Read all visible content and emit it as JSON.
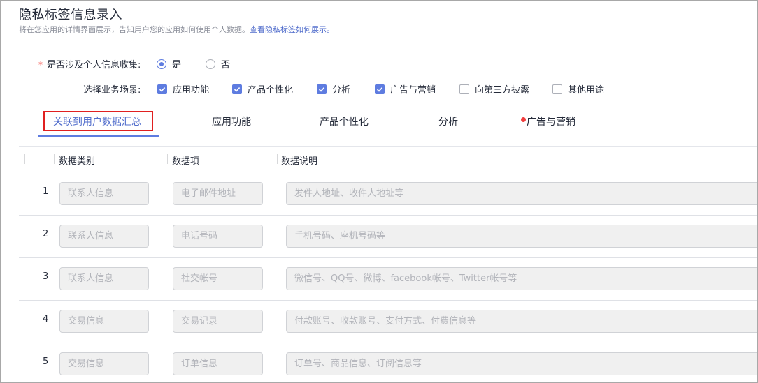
{
  "header": {
    "title": "隐私标签信息录入",
    "subtitle": "将在您应用的详情界面展示，告知用户您的应用如何使用个人数据。",
    "subtitle_link": "查看隐私标签如何展示。"
  },
  "collection": {
    "required_mark": "*",
    "label": "是否涉及个人信息收集:",
    "options": [
      {
        "label": "是",
        "checked": true
      },
      {
        "label": "否",
        "checked": false
      }
    ]
  },
  "scenarios": {
    "label": "选择业务场景:",
    "items": [
      {
        "label": "应用功能",
        "checked": true
      },
      {
        "label": "产品个性化",
        "checked": true
      },
      {
        "label": "分析",
        "checked": true
      },
      {
        "label": "广告与营销",
        "checked": true
      },
      {
        "label": "向第三方披露",
        "checked": false
      },
      {
        "label": "其他用途",
        "checked": false
      }
    ]
  },
  "tabs": [
    {
      "label": "关联到用户数据汇总",
      "active": true
    },
    {
      "label": "应用功能"
    },
    {
      "label": "产品个性化"
    },
    {
      "label": "分析"
    },
    {
      "label": "广告与营销",
      "dot": true
    }
  ],
  "table": {
    "columns": [
      "数据类别",
      "数据项",
      "数据说明"
    ],
    "rows": [
      {
        "index": "1",
        "category": "联系人信息",
        "item": "电子邮件地址",
        "desc": "发件人地址、收件人地址等"
      },
      {
        "index": "2",
        "category": "联系人信息",
        "item": "电话号码",
        "desc": "手机号码、座机号码等"
      },
      {
        "index": "3",
        "category": "联系人信息",
        "item": "社交帐号",
        "desc": "微信号、QQ号、微博、facebook帐号、Twitter帐号等"
      },
      {
        "index": "4",
        "category": "交易信息",
        "item": "交易记录",
        "desc": "付款账号、收款账号、支付方式、付费信息等"
      },
      {
        "index": "5",
        "category": "交易信息",
        "item": "订单信息",
        "desc": "订单号、商品信息、订阅信息等"
      }
    ]
  },
  "colors": {
    "accent": "#5e7ce0",
    "link": "#526ecc",
    "highlight_border": "#e02020",
    "dot": "#f03e3e"
  }
}
